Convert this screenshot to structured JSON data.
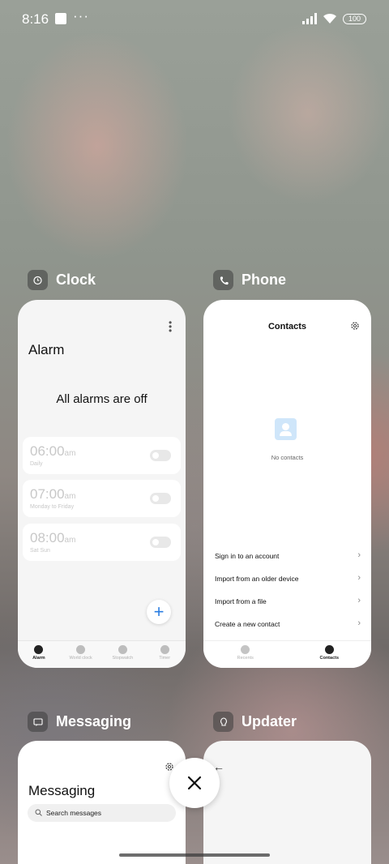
{
  "status_bar": {
    "time": "8:16",
    "more": "···",
    "battery": "100"
  },
  "recents": [
    {
      "app": "Clock",
      "icon": "alarm-clock-icon"
    },
    {
      "app": "Phone",
      "icon": "phone-icon"
    },
    {
      "app": "Messaging",
      "icon": "message-icon"
    },
    {
      "app": "Updater",
      "icon": "updater-icon"
    }
  ],
  "clock": {
    "title": "Alarm",
    "status": "All alarms are off",
    "alarms": [
      {
        "time": "06:00",
        "ampm": "am",
        "days": "Daily",
        "enabled": false
      },
      {
        "time": "07:00",
        "ampm": "am",
        "days": "Monday to Friday",
        "enabled": false
      },
      {
        "time": "08:00",
        "ampm": "am",
        "days": "Sat Sun",
        "enabled": false
      }
    ],
    "add": "+",
    "tabs": [
      {
        "label": "Alarm",
        "icon": "alarm-icon",
        "active": true
      },
      {
        "label": "World clock",
        "icon": "world-clock-icon",
        "active": false
      },
      {
        "label": "Stopwatch",
        "icon": "stopwatch-icon",
        "active": false
      },
      {
        "label": "Timer",
        "icon": "timer-icon",
        "active": false
      }
    ]
  },
  "phone": {
    "title": "Contacts",
    "empty_text": "No contacts",
    "options": [
      "Sign in to an account",
      "Import from an older device",
      "Import from a file",
      "Create a new contact"
    ],
    "tabs": [
      {
        "label": "Recents",
        "icon": "recents-phone-icon",
        "active": false
      },
      {
        "label": "Contacts",
        "icon": "contacts-icon",
        "active": true
      }
    ]
  },
  "messaging": {
    "title": "Messaging",
    "search_placeholder": "Search messages"
  },
  "updater": {
    "back": "←"
  },
  "colors": {
    "accent": "#2a7de1",
    "empty_icon": "#cfe6fa"
  }
}
